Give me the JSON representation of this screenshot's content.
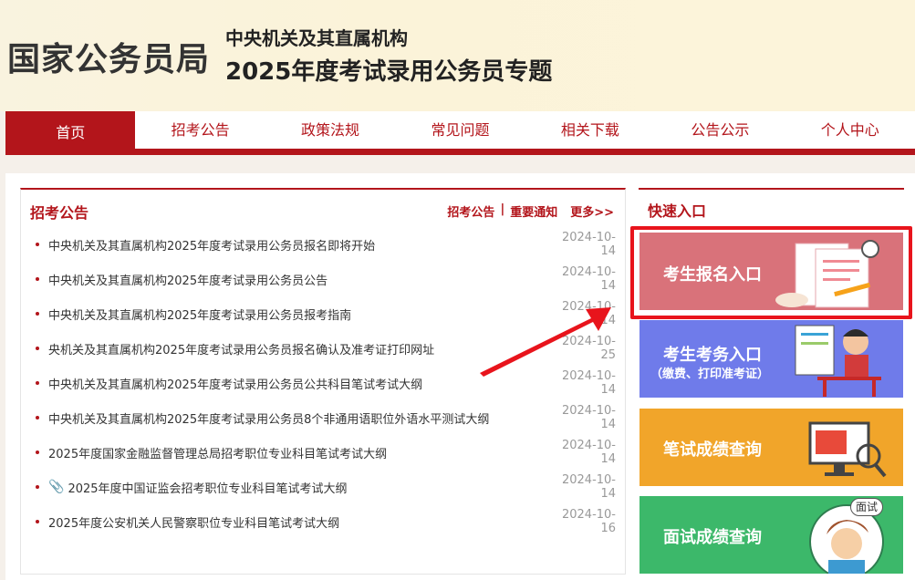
{
  "header": {
    "logo": "国家公务员局",
    "title_line1": "中央机关及其直属机构",
    "title_line2": "2025年度考试录用公务员专题"
  },
  "nav": {
    "items": [
      "首页",
      "招考公告",
      "政策法规",
      "常见问题",
      "相关下载",
      "公告公示",
      "个人中心"
    ],
    "active": "首页"
  },
  "announcements": {
    "title": "招考公告",
    "link1": "招考公告",
    "link_sep": "|",
    "link2": "重要通知",
    "more": "更多>>",
    "items": [
      {
        "title": "中央机关及其直属机构2025年度考试录用公务员报名即将开始",
        "date": "2024-10-14"
      },
      {
        "title": "中央机关及其直属机构2025年度考试录用公务员公告",
        "date": "2024-10-14"
      },
      {
        "title": "中央机关及其直属机构2025年度考试录用公务员报考指南",
        "date": "2024-10-14"
      },
      {
        "title": "央机关及其直属机构2025年度考试录用公务员报名确认及准考证打印网址",
        "date": "2024-10-25"
      },
      {
        "title": "中央机关及其直属机构2025年度考试录用公务员公共科目笔试考试大纲",
        "date": "2024-10-14"
      },
      {
        "title": "中央机关及其直属机构2025年度考试录用公务员8个非通用语职位外语水平测试大纲",
        "date": "2024-10-14"
      },
      {
        "title": "2025年度国家金融监督管理总局招考职位专业科目笔试考试大纲",
        "date": "2024-10-14"
      },
      {
        "title": "2025年度中国证监会招考职位专业科目笔试考试大纲",
        "date": "2024-10-14"
      },
      {
        "title": "2025年度公安机关人民警察职位专业科目笔试考试大纲",
        "date": "2024-10-16"
      }
    ]
  },
  "quick": {
    "title": "快速入口",
    "cards": [
      {
        "label": "考生报名入口",
        "color": "#d9727a"
      },
      {
        "label": "考生考务入口",
        "sub": "（缴费、打印准考证）",
        "color": "#6f7bea"
      },
      {
        "label": "笔试成绩查询",
        "color": "#f1a52a"
      },
      {
        "label": "面试成绩查询",
        "color": "#3cb86a",
        "badge": "面试"
      }
    ]
  },
  "annotation": {
    "highlight_color": "#e8141c"
  }
}
